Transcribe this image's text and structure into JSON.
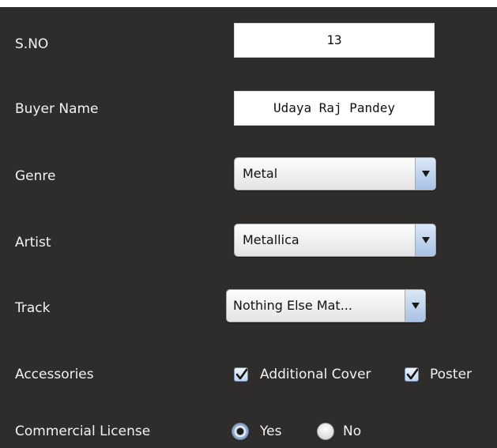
{
  "form": {
    "sno": {
      "label": "S.NO",
      "value": "13"
    },
    "buyer_name": {
      "label": "Buyer Name",
      "value": "Udaya Raj Pandey"
    },
    "genre": {
      "label": "Genre",
      "selected": "Metal"
    },
    "artist": {
      "label": "Artist",
      "selected": "Metallica"
    },
    "track": {
      "label": "Track",
      "selected": "Nothing Else Mat..."
    },
    "accessories": {
      "label": "Accessories",
      "options": [
        {
          "label": "Additional Cover",
          "checked": true
        },
        {
          "label": "Poster",
          "checked": true
        }
      ]
    },
    "commercial_license": {
      "label": "Commercial License",
      "options": [
        {
          "label": "Yes",
          "selected": true
        },
        {
          "label": "No",
          "selected": false
        }
      ]
    }
  },
  "colors": {
    "panel_background": "#2f2d2c",
    "label_text": "#f2f2f2",
    "field_background": "#ffffff",
    "accent": "#a8c1e4"
  }
}
